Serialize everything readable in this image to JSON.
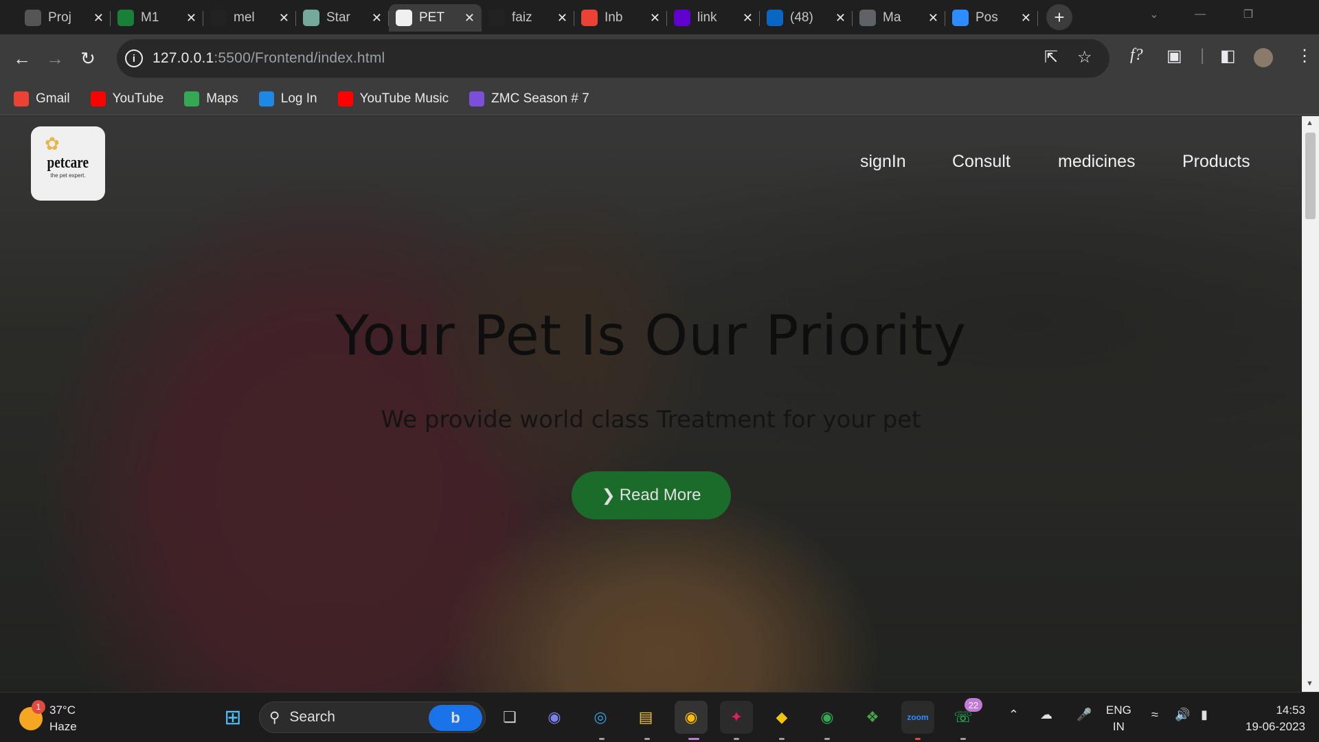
{
  "browser": {
    "tabs": [
      {
        "title": "Proj",
        "favicon": "puppy-icon",
        "color": "#555555"
      },
      {
        "title": "M1",
        "favicon": "sheets-icon",
        "color": "#188038"
      },
      {
        "title": "mel",
        "favicon": "github-icon",
        "color": "#222222"
      },
      {
        "title": "Star",
        "favicon": "chatgpt-icon",
        "color": "#74aa9c"
      },
      {
        "title": "PET",
        "favicon": "petcare-icon",
        "color": "#f0f0f0",
        "active": true
      },
      {
        "title": "faiz",
        "favicon": "github-icon",
        "color": "#222222"
      },
      {
        "title": "Inb",
        "favicon": "gmail-icon",
        "color": "#ea4335"
      },
      {
        "title": "link",
        "favicon": "yahoo-icon",
        "color": "#6001d2"
      },
      {
        "title": "(48)",
        "favicon": "linkedin-icon",
        "color": "#0a66c2"
      },
      {
        "title": "Ma",
        "favicon": "globe-icon",
        "color": "#5f6368"
      },
      {
        "title": "Pos",
        "favicon": "zoom-icon",
        "color": "#2d8cff"
      }
    ],
    "new_tab": "+",
    "url_host": "127.0.0.1",
    "url_rest": ":5500/Frontend/index.html",
    "bookmarks": [
      {
        "label": "Gmail",
        "icon": "gmail-icon",
        "color": "#ea4335"
      },
      {
        "label": "YouTube",
        "icon": "youtube-icon",
        "color": "#ff0000"
      },
      {
        "label": "Maps",
        "icon": "maps-icon",
        "color": "#34a853"
      },
      {
        "label": "Log In",
        "icon": "login-icon",
        "color": "#1e88e5"
      },
      {
        "label": "YouTube Music",
        "icon": "youtube-music-icon",
        "color": "#ff0000"
      },
      {
        "label": "ZMC Season # 7",
        "icon": "list-icon",
        "color": "#7b4fd8"
      }
    ]
  },
  "page": {
    "logo": {
      "name": "petcare",
      "tagline": "the pet expert."
    },
    "nav": [
      "signIn",
      "Consult",
      "medicines",
      "Products"
    ],
    "hero_title": "Your Pet Is Our Priority",
    "hero_subtitle": "We provide world class Treatment for your pet",
    "cta_label": "Read More"
  },
  "taskbar": {
    "weather_temp": "37°C",
    "weather_desc": "Haze",
    "weather_badge": "1",
    "search_placeholder": "Search",
    "whatsapp_badge": "22",
    "lang_line1": "ENG",
    "lang_line2": "IN",
    "time": "14:53",
    "date": "19-06-2023"
  }
}
